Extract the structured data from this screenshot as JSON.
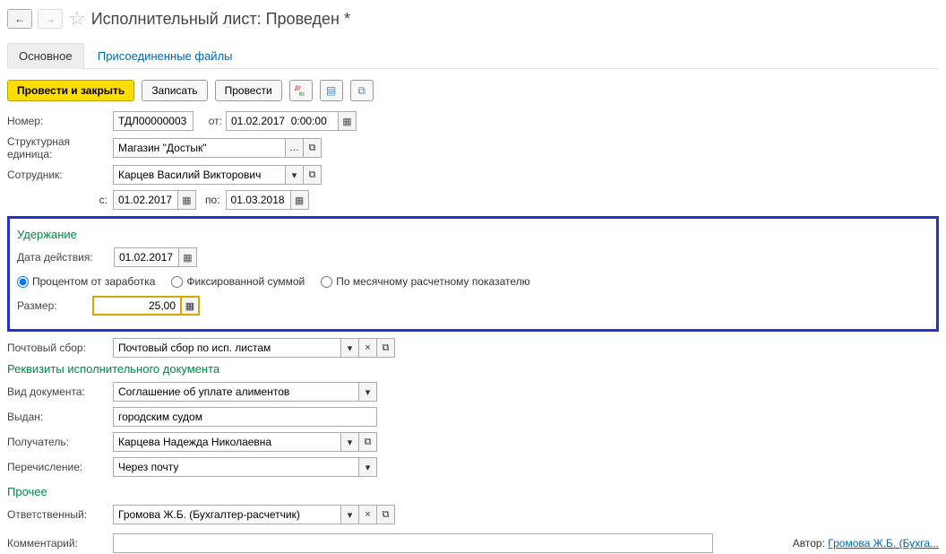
{
  "header": {
    "title": "Исполнительный лист: Проведен *"
  },
  "tabs": {
    "main": "Основное",
    "files": "Присоединенные файлы"
  },
  "toolbar": {
    "post_close": "Провести и закрыть",
    "save": "Записать",
    "post": "Провести"
  },
  "fields": {
    "number_label": "Номер:",
    "number": "ТДЛ00000003",
    "from_label": "от:",
    "date": "01.02.2017  0:00:00",
    "unit_label": "Структурная единица:",
    "unit": "Магазин \"Достык\"",
    "employee_label": "Сотрудник:",
    "employee": "Карцев Василий Викторович",
    "period_from_label": "с:",
    "period_from": "01.02.2017",
    "period_to_label": "по:",
    "period_to": "01.03.2018"
  },
  "deduction": {
    "title": "Удержание",
    "date_label": "Дата действия:",
    "date": "01.02.2017",
    "radio_percent": "Процентом от заработка",
    "radio_fixed": "Фиксированной суммой",
    "radio_monthly": "По месячному расчетному показателю",
    "size_label": "Размер:",
    "size": "25,00"
  },
  "postal": {
    "label": "Почтовый сбор:",
    "value": "Почтовый сбор по исп. листам"
  },
  "requisites": {
    "title": "Реквизиты исполнительного документа",
    "doctype_label": "Вид документа:",
    "doctype": "Соглашение об уплате алиментов",
    "issued_label": "Выдан:",
    "issued": "городским судом",
    "recipient_label": "Получатель:",
    "recipient": "Карцева Надежда Николаевна",
    "transfer_label": "Перечисление:",
    "transfer": "Через почту"
  },
  "other": {
    "title": "Прочее",
    "responsible_label": "Ответственный:",
    "responsible": "Громова Ж.Б. (Бухгалтер-расчетчик)",
    "comment_label": "Комментарий:",
    "comment": "",
    "author_label": "Автор:",
    "author_link": "Громова Ж.Б. (Бухга..."
  }
}
